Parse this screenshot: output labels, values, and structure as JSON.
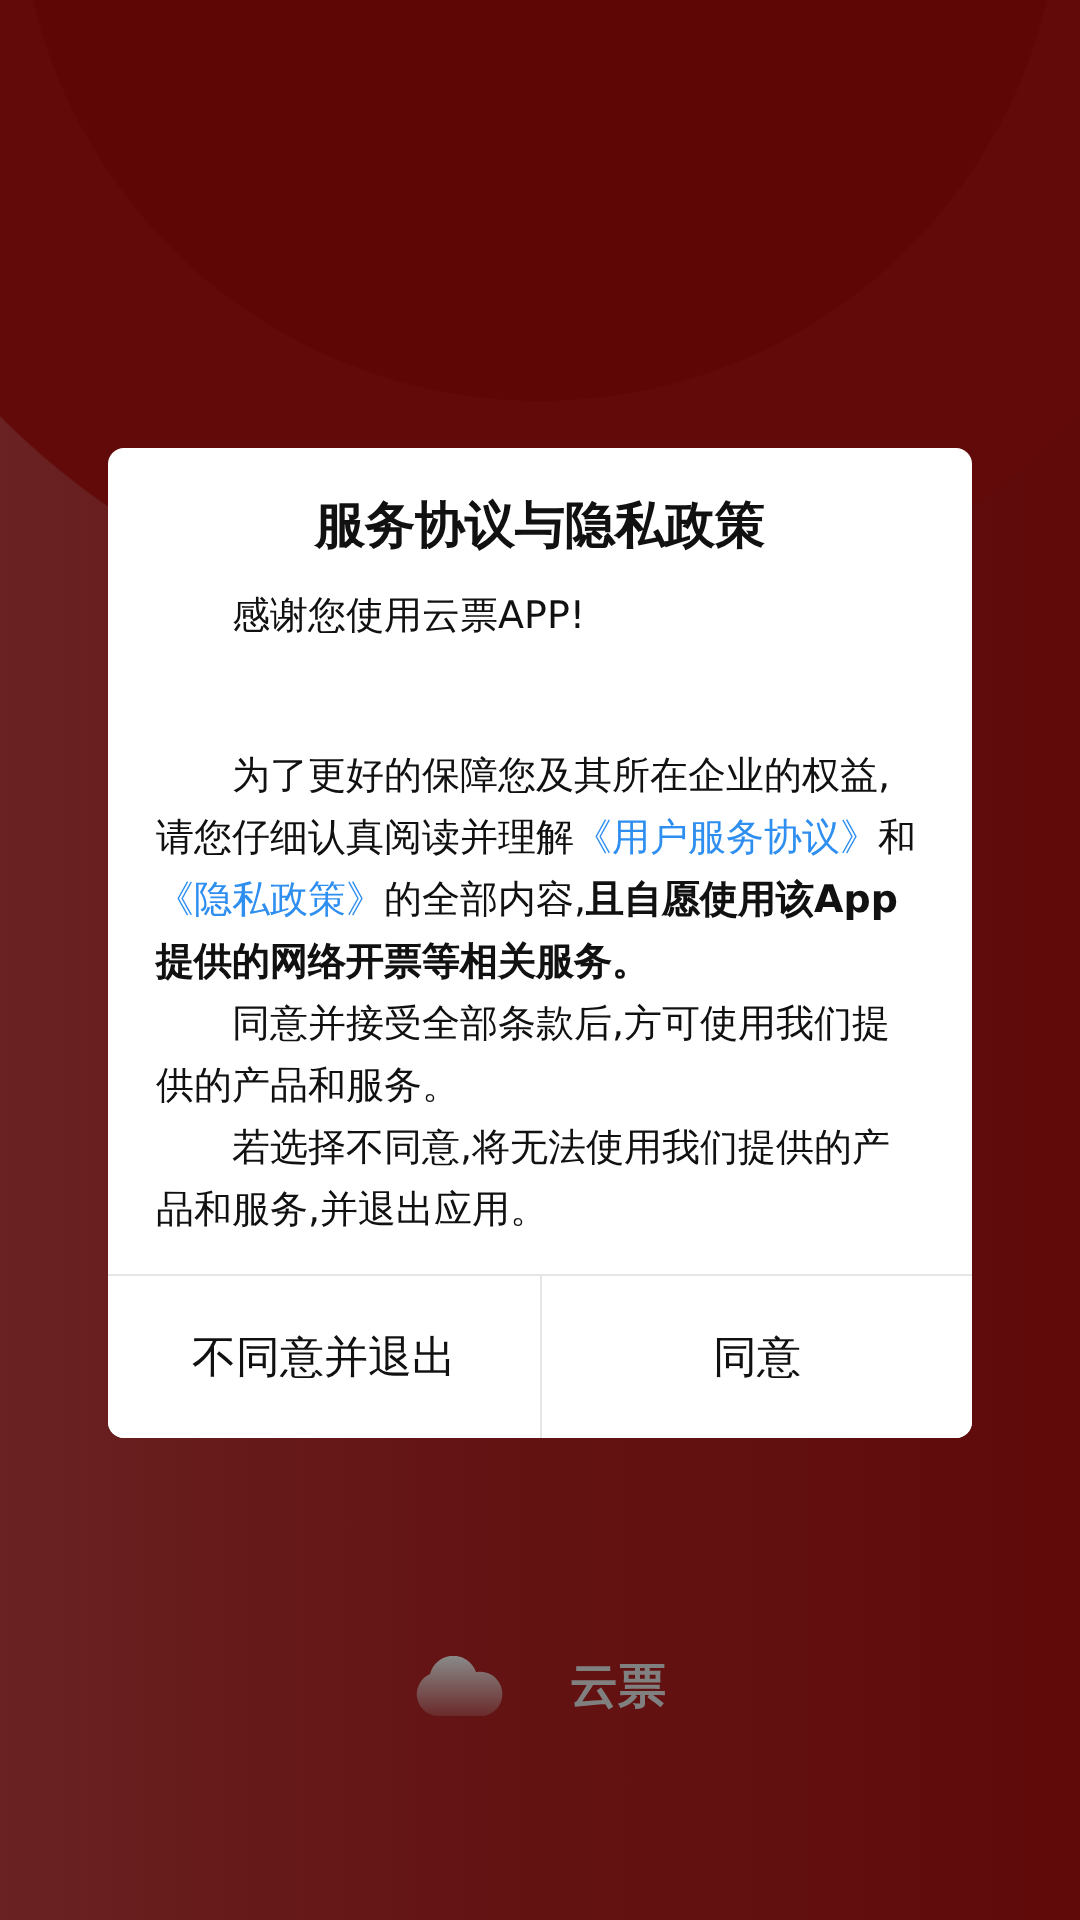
{
  "dialog": {
    "title": "服务协议与隐私政策",
    "paragraphs": [
      {
        "kind": "greeting",
        "parts": [
          {
            "kind": "plain",
            "text": "感谢您使用云票APP!"
          }
        ]
      },
      {
        "kind": "body",
        "parts": [
          {
            "kind": "plain",
            "text": "为了更好的保障您及其所在企业的权益,请您仔细认真阅读并理解"
          },
          {
            "kind": "link",
            "text": "《用户服务协议》"
          },
          {
            "kind": "plain",
            "text": "和"
          },
          {
            "kind": "link",
            "text": "《隐私政策》"
          },
          {
            "kind": "plain",
            "text": "的全部内容,"
          },
          {
            "kind": "bold",
            "text": "且自愿使用该App提供的网络开票等相关服务。"
          }
        ]
      },
      {
        "kind": "body",
        "parts": [
          {
            "kind": "plain",
            "text": "同意并接受全部条款后,方可使用我们提供的产品和服务。"
          }
        ]
      },
      {
        "kind": "body",
        "parts": [
          {
            "kind": "plain",
            "text": "若选择不同意,将无法使用我们提供的产品和服务,并退出应用。"
          }
        ]
      }
    ],
    "buttons": [
      {
        "label": "不同意并退出"
      },
      {
        "label": "同意"
      }
    ]
  },
  "brand": {
    "name": "云票"
  }
}
